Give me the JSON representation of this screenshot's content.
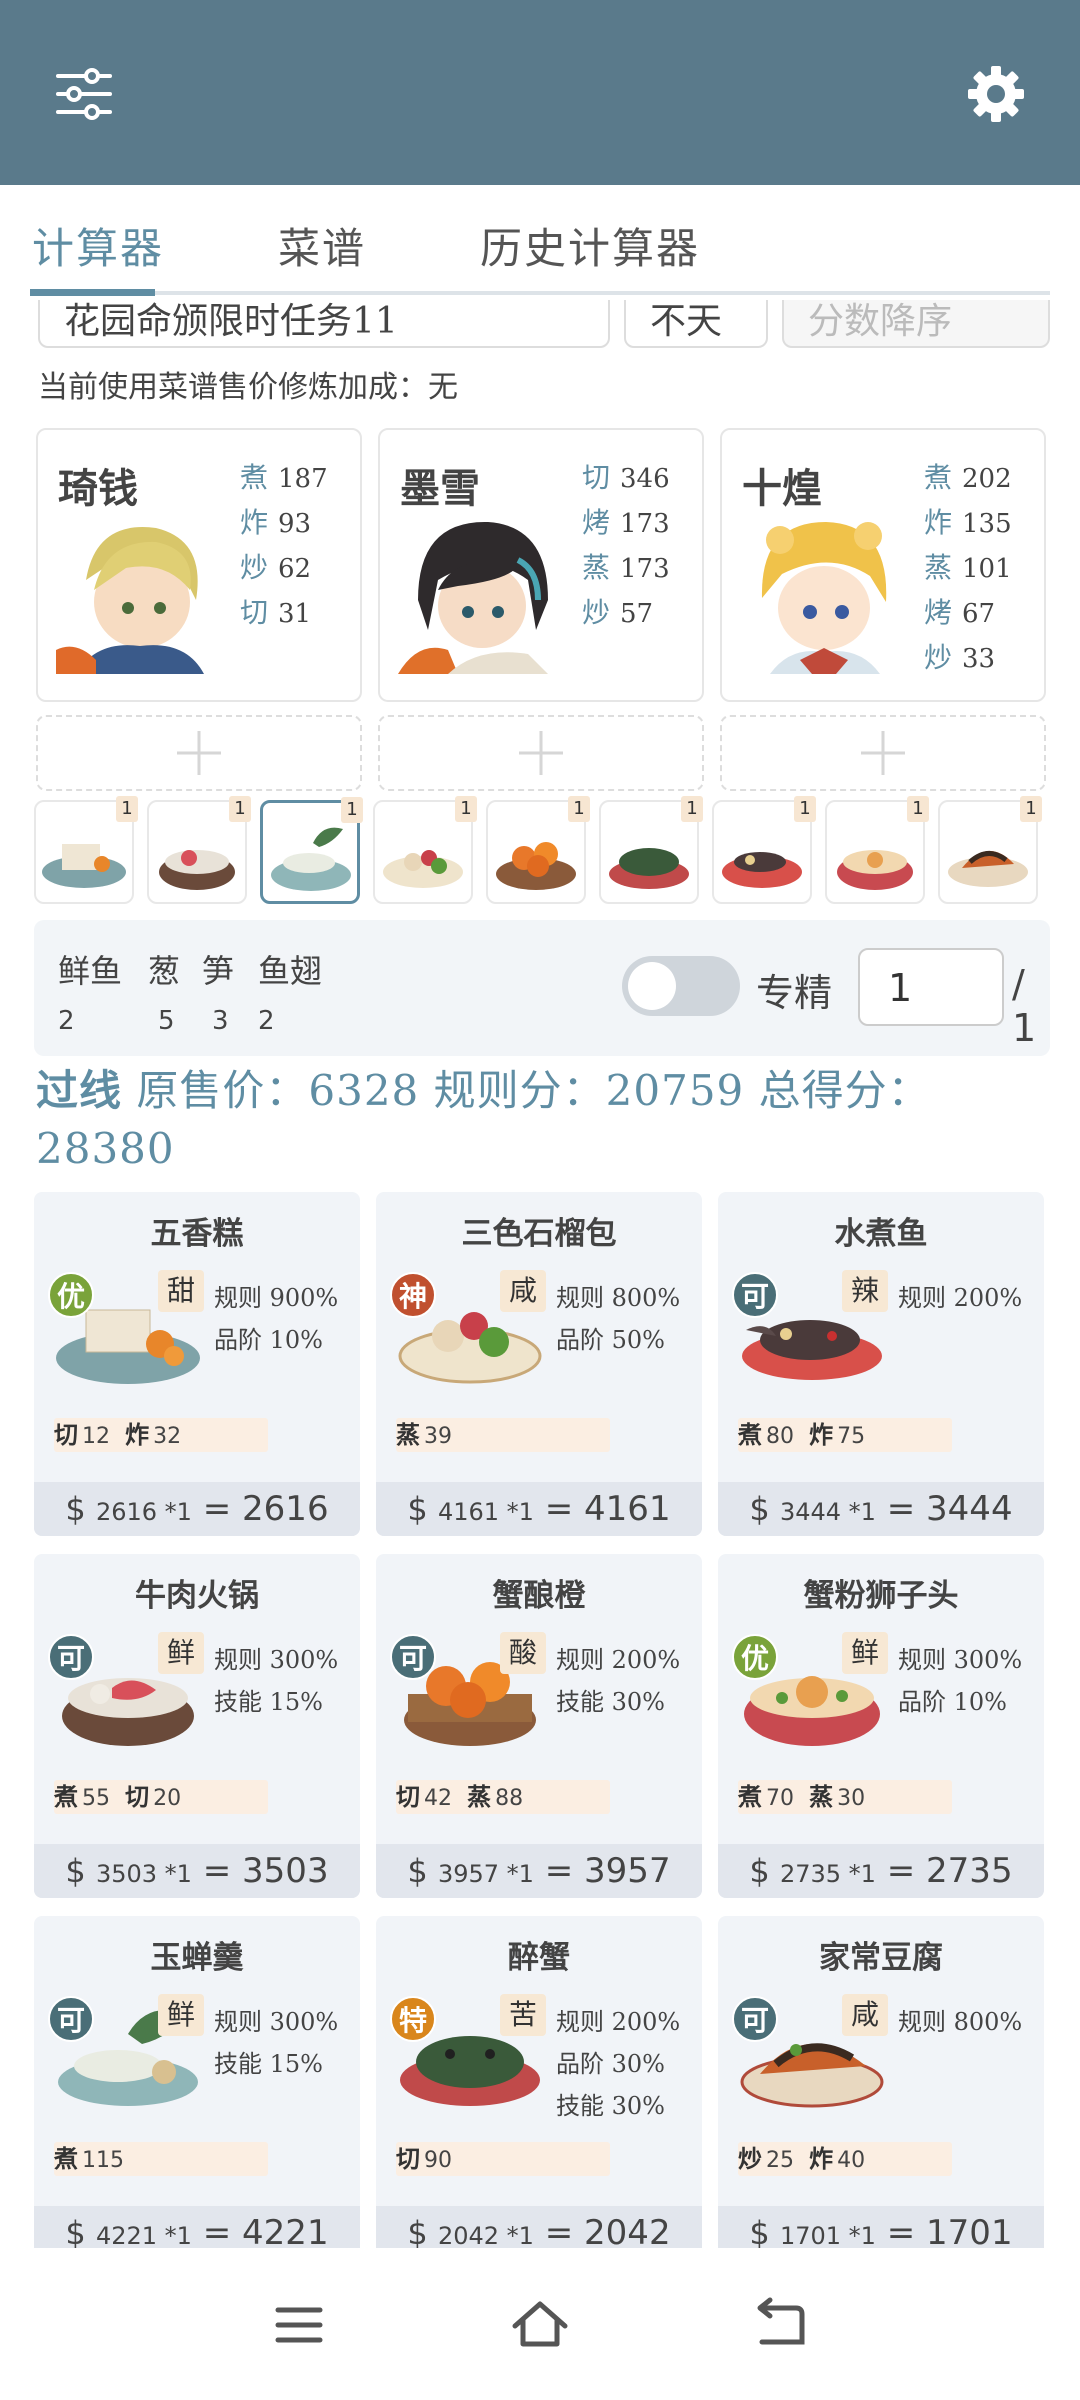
{
  "topbar": {
    "menu_icon": "sliders-icon",
    "settings_icon": "gear-icon"
  },
  "tabs": [
    {
      "label": "计算器",
      "active": true
    },
    {
      "label": "菜谱",
      "active": false
    },
    {
      "label": "历史计算器",
      "active": false
    }
  ],
  "filters": {
    "rule_select": "花园命颁限时任务11",
    "day_select": "不天",
    "sort_select": "分数降序"
  },
  "bonus_text": "当前使用菜谱售价修炼加成：无",
  "chefs": [
    {
      "name": "琦钱",
      "stats": [
        {
          "k": "煮",
          "v": "187"
        },
        {
          "k": "炸",
          "v": "93"
        },
        {
          "k": "炒",
          "v": "62"
        },
        {
          "k": "切",
          "v": "31"
        }
      ]
    },
    {
      "name": "墨雪",
      "stats": [
        {
          "k": "切",
          "v": "346"
        },
        {
          "k": "烤",
          "v": "173"
        },
        {
          "k": "蒸",
          "v": "173"
        },
        {
          "k": "炒",
          "v": "57"
        }
      ]
    },
    {
      "name": "十煌",
      "stats": [
        {
          "k": "煮",
          "v": "202"
        },
        {
          "k": "炸",
          "v": "135"
        },
        {
          "k": "蒸",
          "v": "101"
        },
        {
          "k": "烤",
          "v": "67"
        },
        {
          "k": "炒",
          "v": "33"
        }
      ]
    }
  ],
  "dish_strip": [
    {
      "name": "五香糕",
      "count": "1"
    },
    {
      "name": "牛肉火锅",
      "count": "1"
    },
    {
      "name": "玉蝉羹",
      "count": "1"
    },
    {
      "name": "三色石榴包",
      "count": "1"
    },
    {
      "name": "蟹酿橙",
      "count": "1"
    },
    {
      "name": "醉蟹",
      "count": "1"
    },
    {
      "name": "水煮鱼",
      "count": "1"
    },
    {
      "name": "蟹粉狮子头",
      "count": "1"
    },
    {
      "name": "家常豆腐",
      "count": "1"
    }
  ],
  "ingredients": [
    {
      "name": "鲜鱼",
      "qty": "2"
    },
    {
      "name": "葱",
      "qty": "5"
    },
    {
      "name": "笋",
      "qty": "3"
    },
    {
      "name": "鱼翅",
      "qty": "2"
    }
  ],
  "specialize": {
    "label": "专精",
    "value": "1",
    "total": "/ 1",
    "enabled": false
  },
  "summary": {
    "pass": "过线",
    "orig_label": "原售价：",
    "orig_value": "6328",
    "rule_label": "规则分：",
    "rule_value": "20759",
    "total_label": "总得分：",
    "total_value": "28380"
  },
  "recipes": [
    {
      "name": "五香糕",
      "grade": "优",
      "grade_color": "#7aa33a",
      "taste": "甜",
      "rules": [
        "规则 900%",
        "品阶 10%"
      ],
      "skills": [
        {
          "k": "切",
          "v": "12"
        },
        {
          "k": "炸",
          "v": "32"
        }
      ],
      "price": "2616",
      "mult": "*1",
      "total": "2616"
    },
    {
      "name": "三色石榴包",
      "grade": "神",
      "grade_color": "#c0502f",
      "taste": "咸",
      "rules": [
        "规则 800%",
        "品阶 50%"
      ],
      "skills": [
        {
          "k": "蒸",
          "v": "39"
        }
      ],
      "price": "4161",
      "mult": "*1",
      "total": "4161"
    },
    {
      "name": "水煮鱼",
      "grade": "可",
      "grade_color": "#4a6e77",
      "taste": "辣",
      "rules": [
        "规则 200%"
      ],
      "skills": [
        {
          "k": "煮",
          "v": "80"
        },
        {
          "k": "炸",
          "v": "75"
        }
      ],
      "price": "3444",
      "mult": "*1",
      "total": "3444"
    },
    {
      "name": "牛肉火锅",
      "grade": "可",
      "grade_color": "#4a6e77",
      "taste": "鲜",
      "rules": [
        "规则 300%",
        "技能 15%"
      ],
      "skills": [
        {
          "k": "煮",
          "v": "55"
        },
        {
          "k": "切",
          "v": "20"
        }
      ],
      "price": "3503",
      "mult": "*1",
      "total": "3503"
    },
    {
      "name": "蟹酿橙",
      "grade": "可",
      "grade_color": "#4a6e77",
      "taste": "酸",
      "rules": [
        "规则 200%",
        "技能 30%"
      ],
      "skills": [
        {
          "k": "切",
          "v": "42"
        },
        {
          "k": "蒸",
          "v": "88"
        }
      ],
      "price": "3957",
      "mult": "*1",
      "total": "3957"
    },
    {
      "name": "蟹粉狮子头",
      "grade": "优",
      "grade_color": "#7aa33a",
      "taste": "鲜",
      "rules": [
        "规则 300%",
        "品阶 10%"
      ],
      "skills": [
        {
          "k": "煮",
          "v": "70"
        },
        {
          "k": "蒸",
          "v": "30"
        }
      ],
      "price": "2735",
      "mult": "*1",
      "total": "2735"
    },
    {
      "name": "玉蝉羹",
      "grade": "可",
      "grade_color": "#4a6e77",
      "taste": "鲜",
      "rules": [
        "规则 300%",
        "技能 15%"
      ],
      "skills": [
        {
          "k": "煮",
          "v": "115"
        }
      ],
      "price": "4221",
      "mult": "*1",
      "total": "4221"
    },
    {
      "name": "醉蟹",
      "grade": "特",
      "grade_color": "#d9861c",
      "taste": "苦",
      "rules": [
        "规则 200%",
        "品阶 30%",
        "技能 30%"
      ],
      "skills": [
        {
          "k": "切",
          "v": "90"
        }
      ],
      "price": "2042",
      "mult": "*1",
      "total": "2042"
    },
    {
      "name": "家常豆腐",
      "grade": "可",
      "grade_color": "#4a6e77",
      "taste": "咸",
      "rules": [
        "规则 800%"
      ],
      "skills": [
        {
          "k": "炒",
          "v": "25"
        },
        {
          "k": "炸",
          "v": "40"
        }
      ],
      "price": "1701",
      "mult": "*1",
      "total": "1701"
    }
  ],
  "navbar": {
    "menu_icon": "recent-apps-icon",
    "home_icon": "home-icon",
    "back_icon": "back-icon"
  }
}
